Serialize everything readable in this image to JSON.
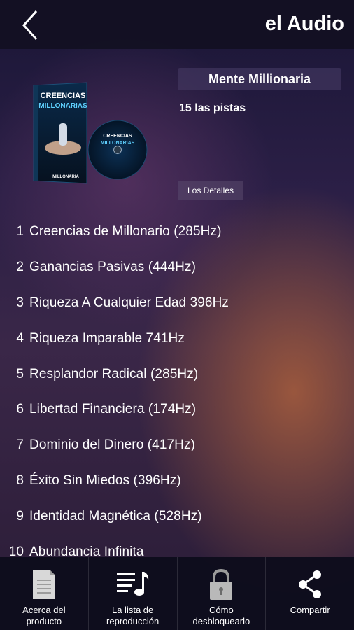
{
  "header": {
    "title": "el Audio"
  },
  "album": {
    "name": "Mente Millionaria",
    "tracks_count": "15 las pistas",
    "details_label": "Los Detalles",
    "cover_title_line1": "CREENCIAS",
    "cover_title_line2": "MILLONARIAS",
    "cover_footer": "MILLONARIA"
  },
  "tracks": [
    {
      "num": "1",
      "title": "Creencias de Millonario (285Hz)"
    },
    {
      "num": "2",
      "title": "Ganancias Pasivas (444Hz)"
    },
    {
      "num": "3",
      "title": "Riqueza A Cualquier Edad 396Hz"
    },
    {
      "num": "4",
      "title": "Riqueza Imparable 741Hz"
    },
    {
      "num": "5",
      "title": "Resplandor Radical (285Hz)"
    },
    {
      "num": "6",
      "title": "Libertad Financiera (174Hz)"
    },
    {
      "num": "7",
      "title": "Dominio del Dinero (417Hz)"
    },
    {
      "num": "8",
      "title": "Éxito Sin Miedos (396Hz)"
    },
    {
      "num": "9",
      "title": "Identidad Magnética (528Hz)"
    },
    {
      "num": "10",
      "title": "Abundancia Infinita"
    }
  ],
  "bottom_nav": [
    {
      "label": "Acerca del\nproducto",
      "icon": "document-icon"
    },
    {
      "label": "La lista de\nreproducción",
      "icon": "playlist-icon"
    },
    {
      "label": "Cómo\ndesbloquearlo",
      "icon": "lock-icon"
    },
    {
      "label": "Compartir",
      "icon": "share-icon"
    }
  ]
}
